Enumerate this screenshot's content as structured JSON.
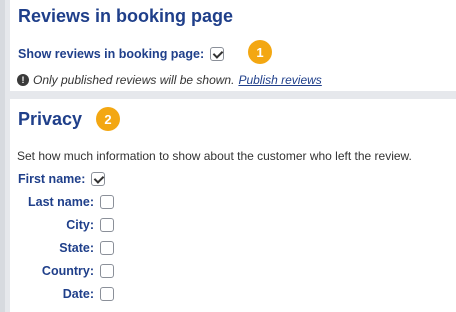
{
  "reviews_section": {
    "title": "Reviews in booking page",
    "show_reviews_label": "Show reviews in booking page:",
    "show_reviews_checked": true,
    "badge_1": "1",
    "info_text": "Only published reviews will be shown.",
    "publish_link": "Publish reviews"
  },
  "privacy_section": {
    "title": "Privacy",
    "badge_2": "2",
    "description": "Set how much information to show about the customer who left the review.",
    "fields": [
      {
        "label": "First name:",
        "checked": true
      },
      {
        "label": "Last name:",
        "checked": false
      },
      {
        "label": "City:",
        "checked": false
      },
      {
        "label": "State:",
        "checked": false
      },
      {
        "label": "Country:",
        "checked": false
      },
      {
        "label": "Date:",
        "checked": false
      }
    ]
  },
  "colors": {
    "title": "#1f3f8a",
    "badge": "#f3a712",
    "background": "#e6e8ec"
  },
  "icons": {
    "info": "exclamation-circle-icon",
    "check": "checkmark-icon"
  }
}
